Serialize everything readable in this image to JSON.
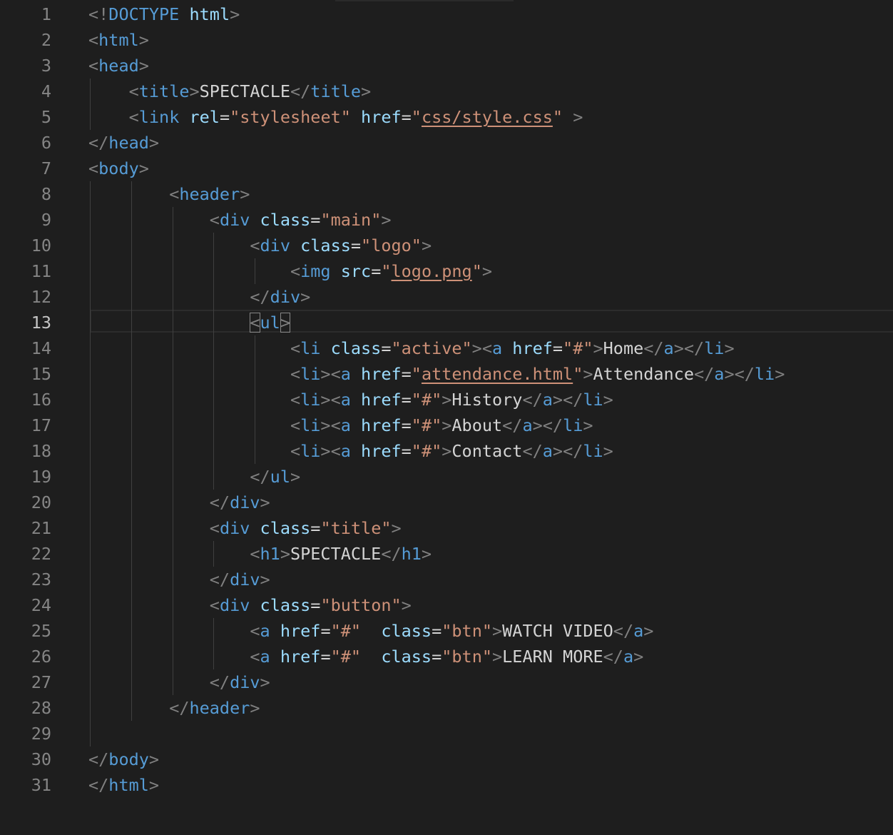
{
  "editor": {
    "current_line": 13,
    "lines": [
      {
        "n": "1",
        "indent": 0,
        "tokens": [
          [
            "p",
            "<!"
          ],
          [
            "t",
            "DOCTYPE"
          ],
          [
            "x",
            " "
          ],
          [
            "a",
            "html"
          ],
          [
            "p",
            ">"
          ]
        ]
      },
      {
        "n": "2",
        "indent": 0,
        "tokens": [
          [
            "p",
            "<"
          ],
          [
            "t",
            "html"
          ],
          [
            "p",
            ">"
          ]
        ]
      },
      {
        "n": "3",
        "indent": 0,
        "tokens": [
          [
            "p",
            "<"
          ],
          [
            "t",
            "head"
          ],
          [
            "p",
            ">"
          ]
        ]
      },
      {
        "n": "4",
        "indent": 4,
        "tokens": [
          [
            "p",
            "<"
          ],
          [
            "t",
            "title"
          ],
          [
            "p",
            ">"
          ],
          [
            "x",
            "SPECTACLE"
          ],
          [
            "p",
            "</"
          ],
          [
            "t",
            "title"
          ],
          [
            "p",
            ">"
          ]
        ]
      },
      {
        "n": "5",
        "indent": 4,
        "tokens": [
          [
            "p",
            "<"
          ],
          [
            "t",
            "link"
          ],
          [
            "x",
            " "
          ],
          [
            "a",
            "rel"
          ],
          [
            "x",
            "="
          ],
          [
            "s",
            "\"stylesheet\""
          ],
          [
            "x",
            " "
          ],
          [
            "a",
            "href"
          ],
          [
            "x",
            "="
          ],
          [
            "s",
            "\""
          ],
          [
            "su",
            "css/style.css"
          ],
          [
            "s",
            "\""
          ],
          [
            "x",
            " "
          ],
          [
            "p",
            ">"
          ]
        ]
      },
      {
        "n": "6",
        "indent": 0,
        "tokens": [
          [
            "p",
            "</"
          ],
          [
            "t",
            "head"
          ],
          [
            "p",
            ">"
          ]
        ]
      },
      {
        "n": "7",
        "indent": 0,
        "tokens": [
          [
            "p",
            "<"
          ],
          [
            "t",
            "body"
          ],
          [
            "p",
            ">"
          ]
        ]
      },
      {
        "n": "8",
        "indent": 8,
        "tokens": [
          [
            "p",
            "<"
          ],
          [
            "t",
            "header"
          ],
          [
            "p",
            ">"
          ]
        ]
      },
      {
        "n": "9",
        "indent": 12,
        "tokens": [
          [
            "p",
            "<"
          ],
          [
            "t",
            "div"
          ],
          [
            "x",
            " "
          ],
          [
            "a",
            "class"
          ],
          [
            "x",
            "="
          ],
          [
            "s",
            "\"main\""
          ],
          [
            "p",
            ">"
          ]
        ]
      },
      {
        "n": "10",
        "indent": 16,
        "tokens": [
          [
            "p",
            "<"
          ],
          [
            "t",
            "div"
          ],
          [
            "x",
            " "
          ],
          [
            "a",
            "class"
          ],
          [
            "x",
            "="
          ],
          [
            "s",
            "\"logo\""
          ],
          [
            "p",
            ">"
          ]
        ]
      },
      {
        "n": "11",
        "indent": 20,
        "tokens": [
          [
            "p",
            "<"
          ],
          [
            "t",
            "img"
          ],
          [
            "x",
            " "
          ],
          [
            "a",
            "src"
          ],
          [
            "x",
            "="
          ],
          [
            "s",
            "\""
          ],
          [
            "su",
            "logo.png"
          ],
          [
            "s",
            "\""
          ],
          [
            "p",
            ">"
          ]
        ]
      },
      {
        "n": "12",
        "indent": 16,
        "tokens": [
          [
            "p",
            "</"
          ],
          [
            "t",
            "div"
          ],
          [
            "p",
            ">"
          ]
        ]
      },
      {
        "n": "13",
        "indent": 16,
        "tokens": [
          [
            "pb",
            "<"
          ],
          [
            "t",
            "ul"
          ],
          [
            "pb",
            ">"
          ]
        ]
      },
      {
        "n": "14",
        "indent": 20,
        "tokens": [
          [
            "p",
            "<"
          ],
          [
            "t",
            "li"
          ],
          [
            "x",
            " "
          ],
          [
            "a",
            "class"
          ],
          [
            "x",
            "="
          ],
          [
            "s",
            "\"active\""
          ],
          [
            "p",
            ">"
          ],
          [
            "p",
            "<"
          ],
          [
            "t",
            "a"
          ],
          [
            "x",
            " "
          ],
          [
            "a",
            "href"
          ],
          [
            "x",
            "="
          ],
          [
            "s",
            "\"#\""
          ],
          [
            "p",
            ">"
          ],
          [
            "x",
            "Home"
          ],
          [
            "p",
            "</"
          ],
          [
            "t",
            "a"
          ],
          [
            "p",
            ">"
          ],
          [
            "p",
            "</"
          ],
          [
            "t",
            "li"
          ],
          [
            "p",
            ">"
          ]
        ]
      },
      {
        "n": "15",
        "indent": 20,
        "tokens": [
          [
            "p",
            "<"
          ],
          [
            "t",
            "li"
          ],
          [
            "p",
            ">"
          ],
          [
            "p",
            "<"
          ],
          [
            "t",
            "a"
          ],
          [
            "x",
            " "
          ],
          [
            "a",
            "href"
          ],
          [
            "x",
            "="
          ],
          [
            "s",
            "\""
          ],
          [
            "su",
            "attendance.html"
          ],
          [
            "s",
            "\""
          ],
          [
            "p",
            ">"
          ],
          [
            "x",
            "Attendance"
          ],
          [
            "p",
            "</"
          ],
          [
            "t",
            "a"
          ],
          [
            "p",
            ">"
          ],
          [
            "p",
            "</"
          ],
          [
            "t",
            "li"
          ],
          [
            "p",
            ">"
          ]
        ]
      },
      {
        "n": "16",
        "indent": 20,
        "tokens": [
          [
            "p",
            "<"
          ],
          [
            "t",
            "li"
          ],
          [
            "p",
            ">"
          ],
          [
            "p",
            "<"
          ],
          [
            "t",
            "a"
          ],
          [
            "x",
            " "
          ],
          [
            "a",
            "href"
          ],
          [
            "x",
            "="
          ],
          [
            "s",
            "\"#\""
          ],
          [
            "p",
            ">"
          ],
          [
            "x",
            "History"
          ],
          [
            "p",
            "</"
          ],
          [
            "t",
            "a"
          ],
          [
            "p",
            ">"
          ],
          [
            "p",
            "</"
          ],
          [
            "t",
            "li"
          ],
          [
            "p",
            ">"
          ]
        ]
      },
      {
        "n": "17",
        "indent": 20,
        "tokens": [
          [
            "p",
            "<"
          ],
          [
            "t",
            "li"
          ],
          [
            "p",
            ">"
          ],
          [
            "p",
            "<"
          ],
          [
            "t",
            "a"
          ],
          [
            "x",
            " "
          ],
          [
            "a",
            "href"
          ],
          [
            "x",
            "="
          ],
          [
            "s",
            "\"#\""
          ],
          [
            "p",
            ">"
          ],
          [
            "x",
            "About"
          ],
          [
            "p",
            "</"
          ],
          [
            "t",
            "a"
          ],
          [
            "p",
            ">"
          ],
          [
            "p",
            "</"
          ],
          [
            "t",
            "li"
          ],
          [
            "p",
            ">"
          ]
        ]
      },
      {
        "n": "18",
        "indent": 20,
        "tokens": [
          [
            "p",
            "<"
          ],
          [
            "t",
            "li"
          ],
          [
            "p",
            ">"
          ],
          [
            "p",
            "<"
          ],
          [
            "t",
            "a"
          ],
          [
            "x",
            " "
          ],
          [
            "a",
            "href"
          ],
          [
            "x",
            "="
          ],
          [
            "s",
            "\"#\""
          ],
          [
            "p",
            ">"
          ],
          [
            "x",
            "Contact"
          ],
          [
            "p",
            "</"
          ],
          [
            "t",
            "a"
          ],
          [
            "p",
            ">"
          ],
          [
            "p",
            "</"
          ],
          [
            "t",
            "li"
          ],
          [
            "p",
            ">"
          ]
        ]
      },
      {
        "n": "19",
        "indent": 16,
        "tokens": [
          [
            "p",
            "</"
          ],
          [
            "t",
            "ul"
          ],
          [
            "p",
            ">"
          ]
        ]
      },
      {
        "n": "20",
        "indent": 12,
        "tokens": [
          [
            "p",
            "</"
          ],
          [
            "t",
            "div"
          ],
          [
            "p",
            ">"
          ]
        ]
      },
      {
        "n": "21",
        "indent": 12,
        "tokens": [
          [
            "p",
            "<"
          ],
          [
            "t",
            "div"
          ],
          [
            "x",
            " "
          ],
          [
            "a",
            "class"
          ],
          [
            "x",
            "="
          ],
          [
            "s",
            "\"title\""
          ],
          [
            "p",
            ">"
          ]
        ]
      },
      {
        "n": "22",
        "indent": 16,
        "tokens": [
          [
            "p",
            "<"
          ],
          [
            "t",
            "h1"
          ],
          [
            "p",
            ">"
          ],
          [
            "x",
            "SPECTACLE"
          ],
          [
            "p",
            "</"
          ],
          [
            "t",
            "h1"
          ],
          [
            "p",
            ">"
          ]
        ]
      },
      {
        "n": "23",
        "indent": 12,
        "tokens": [
          [
            "p",
            "</"
          ],
          [
            "t",
            "div"
          ],
          [
            "p",
            ">"
          ]
        ]
      },
      {
        "n": "24",
        "indent": 12,
        "tokens": [
          [
            "p",
            "<"
          ],
          [
            "t",
            "div"
          ],
          [
            "x",
            " "
          ],
          [
            "a",
            "class"
          ],
          [
            "x",
            "="
          ],
          [
            "s",
            "\"button\""
          ],
          [
            "p",
            ">"
          ]
        ]
      },
      {
        "n": "25",
        "indent": 16,
        "tokens": [
          [
            "p",
            "<"
          ],
          [
            "t",
            "a"
          ],
          [
            "x",
            " "
          ],
          [
            "a",
            "href"
          ],
          [
            "x",
            "="
          ],
          [
            "s",
            "\"#\""
          ],
          [
            "x",
            "  "
          ],
          [
            "a",
            "class"
          ],
          [
            "x",
            "="
          ],
          [
            "s",
            "\"btn\""
          ],
          [
            "p",
            ">"
          ],
          [
            "x",
            "WATCH VIDEO"
          ],
          [
            "p",
            "</"
          ],
          [
            "t",
            "a"
          ],
          [
            "p",
            ">"
          ]
        ]
      },
      {
        "n": "26",
        "indent": 16,
        "tokens": [
          [
            "p",
            "<"
          ],
          [
            "t",
            "a"
          ],
          [
            "x",
            " "
          ],
          [
            "a",
            "href"
          ],
          [
            "x",
            "="
          ],
          [
            "s",
            "\"#\""
          ],
          [
            "x",
            "  "
          ],
          [
            "a",
            "class"
          ],
          [
            "x",
            "="
          ],
          [
            "s",
            "\"btn\""
          ],
          [
            "p",
            ">"
          ],
          [
            "x",
            "LEARN MORE"
          ],
          [
            "p",
            "</"
          ],
          [
            "t",
            "a"
          ],
          [
            "p",
            ">"
          ]
        ]
      },
      {
        "n": "27",
        "indent": 12,
        "tokens": [
          [
            "p",
            "</"
          ],
          [
            "t",
            "div"
          ],
          [
            "p",
            ">"
          ]
        ]
      },
      {
        "n": "28",
        "indent": 8,
        "tokens": [
          [
            "p",
            "</"
          ],
          [
            "t",
            "header"
          ],
          [
            "p",
            ">"
          ]
        ]
      },
      {
        "n": "29",
        "indent": 0,
        "tokens": []
      },
      {
        "n": "30",
        "indent": 0,
        "tokens": [
          [
            "p",
            "</"
          ],
          [
            "t",
            "body"
          ],
          [
            "p",
            ">"
          ]
        ]
      },
      {
        "n": "31",
        "indent": 0,
        "tokens": [
          [
            "p",
            "</"
          ],
          [
            "t",
            "html"
          ],
          [
            "p",
            ">"
          ]
        ]
      }
    ]
  }
}
